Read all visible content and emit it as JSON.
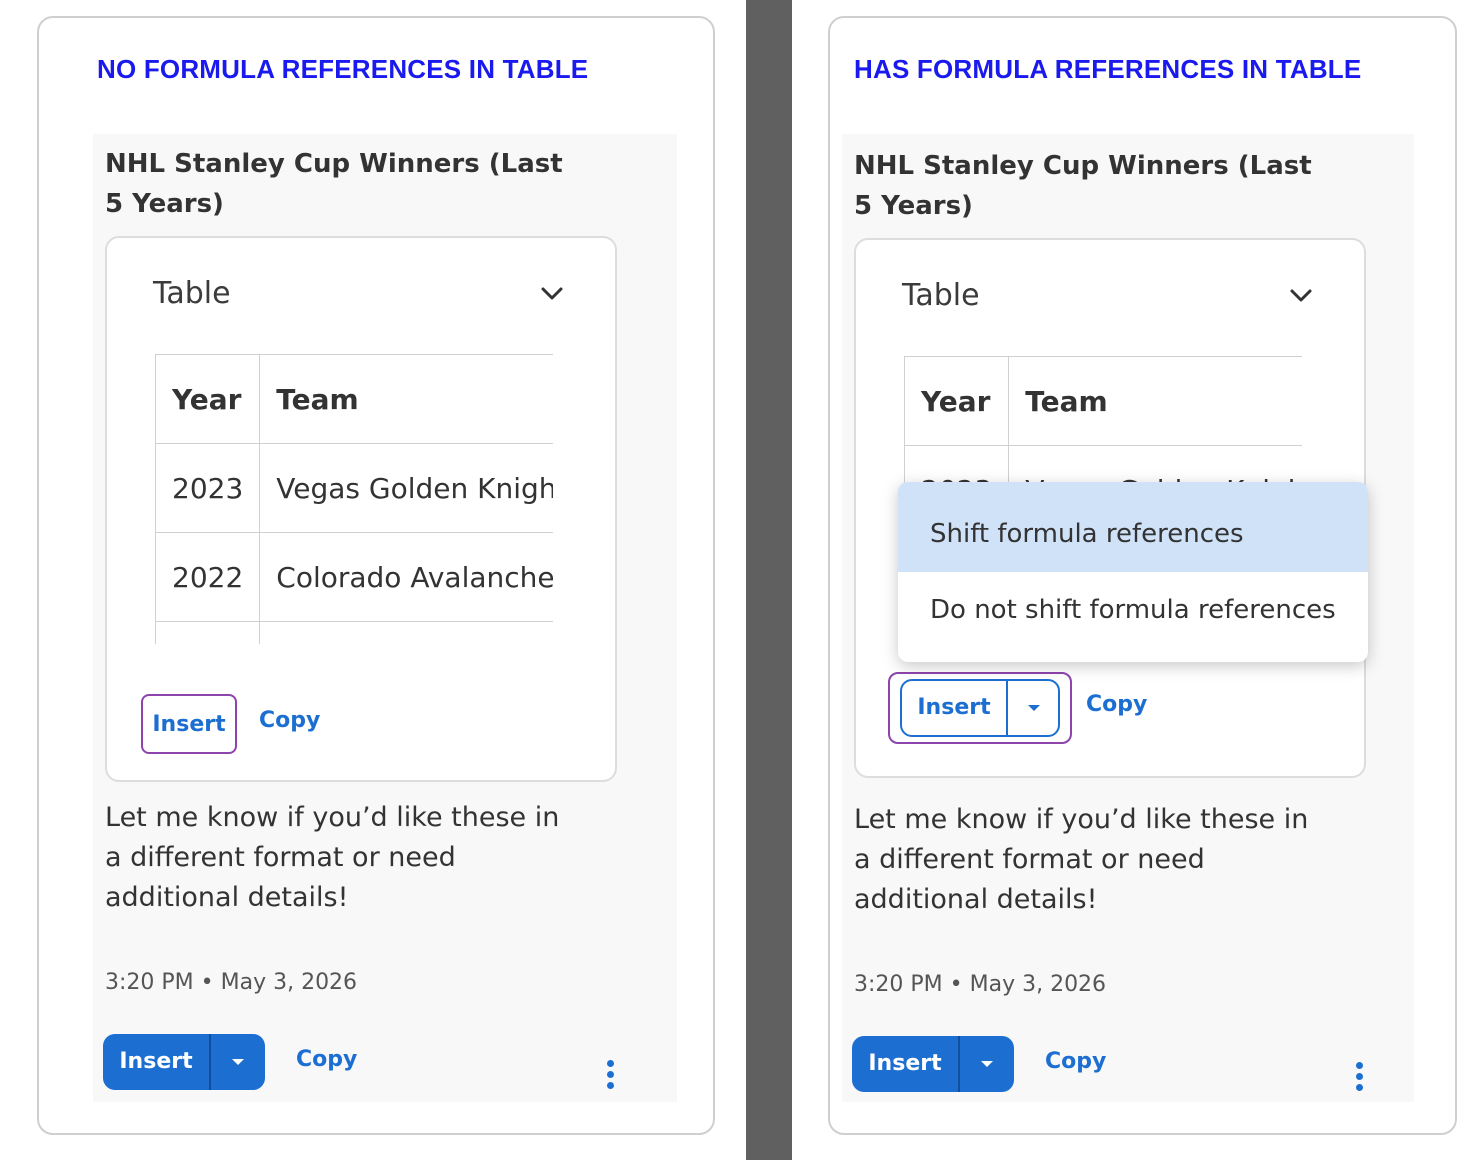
{
  "left_panel": {
    "heading": "NO FORMULA REFERENCES IN TABLE",
    "message_title": "NHL Stanley Cup Winners (Last 5 Years)",
    "table_card_title": "Table",
    "table": {
      "headers": [
        "Year",
        "Team"
      ],
      "rows": [
        [
          "2023",
          "Vegas Golden Knights"
        ],
        [
          "2022",
          "Colorado Avalanche"
        ]
      ]
    },
    "inner_insert_label": "Insert",
    "inner_copy_label": "Copy",
    "follow_text": "Let me know if you’d like these in a different format or need additional details!",
    "timestamp": "3:20 PM • May 3, 2026",
    "bottom_insert_label": "Insert",
    "bottom_copy_label": "Copy"
  },
  "right_panel": {
    "heading": "HAS FORMULA REFERENCES IN TABLE",
    "message_title": "NHL Stanley Cup Winners (Last 5 Years)",
    "table_card_title": "Table",
    "table": {
      "headers": [
        "Year",
        "Team"
      ],
      "rows": [
        [
          "2023",
          "Vegas Golden Knights"
        ]
      ]
    },
    "inner_insert_label": "Insert",
    "inner_copy_label": "Copy",
    "dropdown_options": [
      "Shift formula references",
      "Do not shift formula references"
    ],
    "dropdown_selected": "Shift formula references",
    "follow_text": "Let me know if you’d like these in a different format or need additional details!",
    "timestamp": "3:20 PM • May 3, 2026",
    "bottom_insert_label": "Insert",
    "bottom_copy_label": "Copy"
  },
  "colors": {
    "heading": "#1a1aee",
    "accent": "#1c6fd1",
    "highlight_outline": "#8e44ad",
    "menu_selected": "#cfe2f8",
    "divider": "#606060"
  },
  "icons": [
    "chevron-down-icon",
    "caret-down-icon",
    "more-vertical-icon"
  ]
}
